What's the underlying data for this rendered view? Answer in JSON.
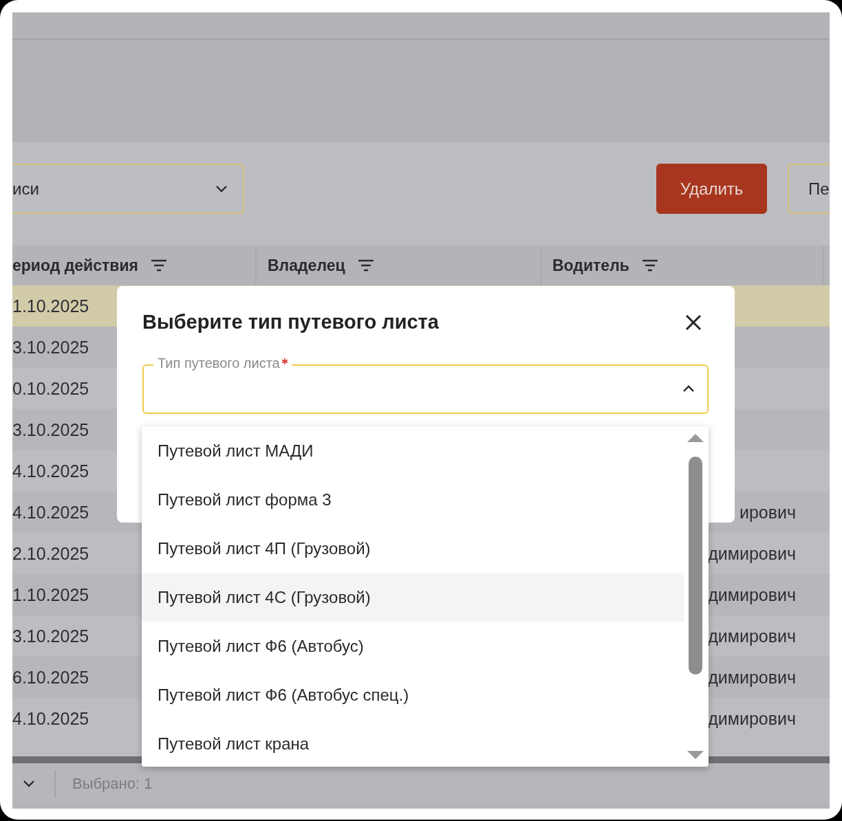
{
  "toolbar": {
    "filter_value": "иси",
    "buttons": [
      {
        "label": "Удалить",
        "kind": "danger"
      },
      {
        "label": "Пе",
        "kind": "outline"
      }
    ]
  },
  "table": {
    "columns": [
      "ериод действия",
      "Владелец",
      "Водитель"
    ],
    "rows": [
      {
        "period": "1.10.2025",
        "selected": true
      },
      {
        "period": "3.10.2025",
        "selected": false
      },
      {
        "period": "0.10.2025",
        "selected": false
      },
      {
        "period": "3.10.2025",
        "selected": false
      },
      {
        "period": "4.10.2025",
        "selected": false
      },
      {
        "period": "4.10.2025",
        "driver": "ирович",
        "selected": false
      },
      {
        "period": "2.10.2025",
        "driver": "димирович",
        "selected": false
      },
      {
        "period": "1.10.2025",
        "driver": "димирович",
        "selected": false
      },
      {
        "period": "3.10.2025",
        "driver": "димирович",
        "selected": false
      },
      {
        "period": "6.10.2025",
        "driver": "димирович",
        "selected": false
      },
      {
        "period": "4.10.2025",
        "driver": "димирович",
        "selected": false
      }
    ]
  },
  "footer": {
    "selected_count": "Выбрано: 1"
  },
  "dialog": {
    "title": "Выберите тип путевого листа",
    "field": {
      "label": "Тип путевого листа",
      "required": true,
      "expanded": true
    },
    "options": [
      {
        "label": "Путевой лист МАДИ",
        "highlighted": false
      },
      {
        "label": "Путевой лист форма 3",
        "highlighted": false
      },
      {
        "label": "Путевой лист 4П (Грузовой)",
        "highlighted": false
      },
      {
        "label": "Путевой лист 4С (Грузовой)",
        "highlighted": true
      },
      {
        "label": "Путевой лист Ф6 (Автобус)",
        "highlighted": false
      },
      {
        "label": "Путевой лист Ф6 (Автобус спец.)",
        "highlighted": false
      },
      {
        "label": "Путевой лист крана",
        "highlighted": false
      }
    ]
  }
}
